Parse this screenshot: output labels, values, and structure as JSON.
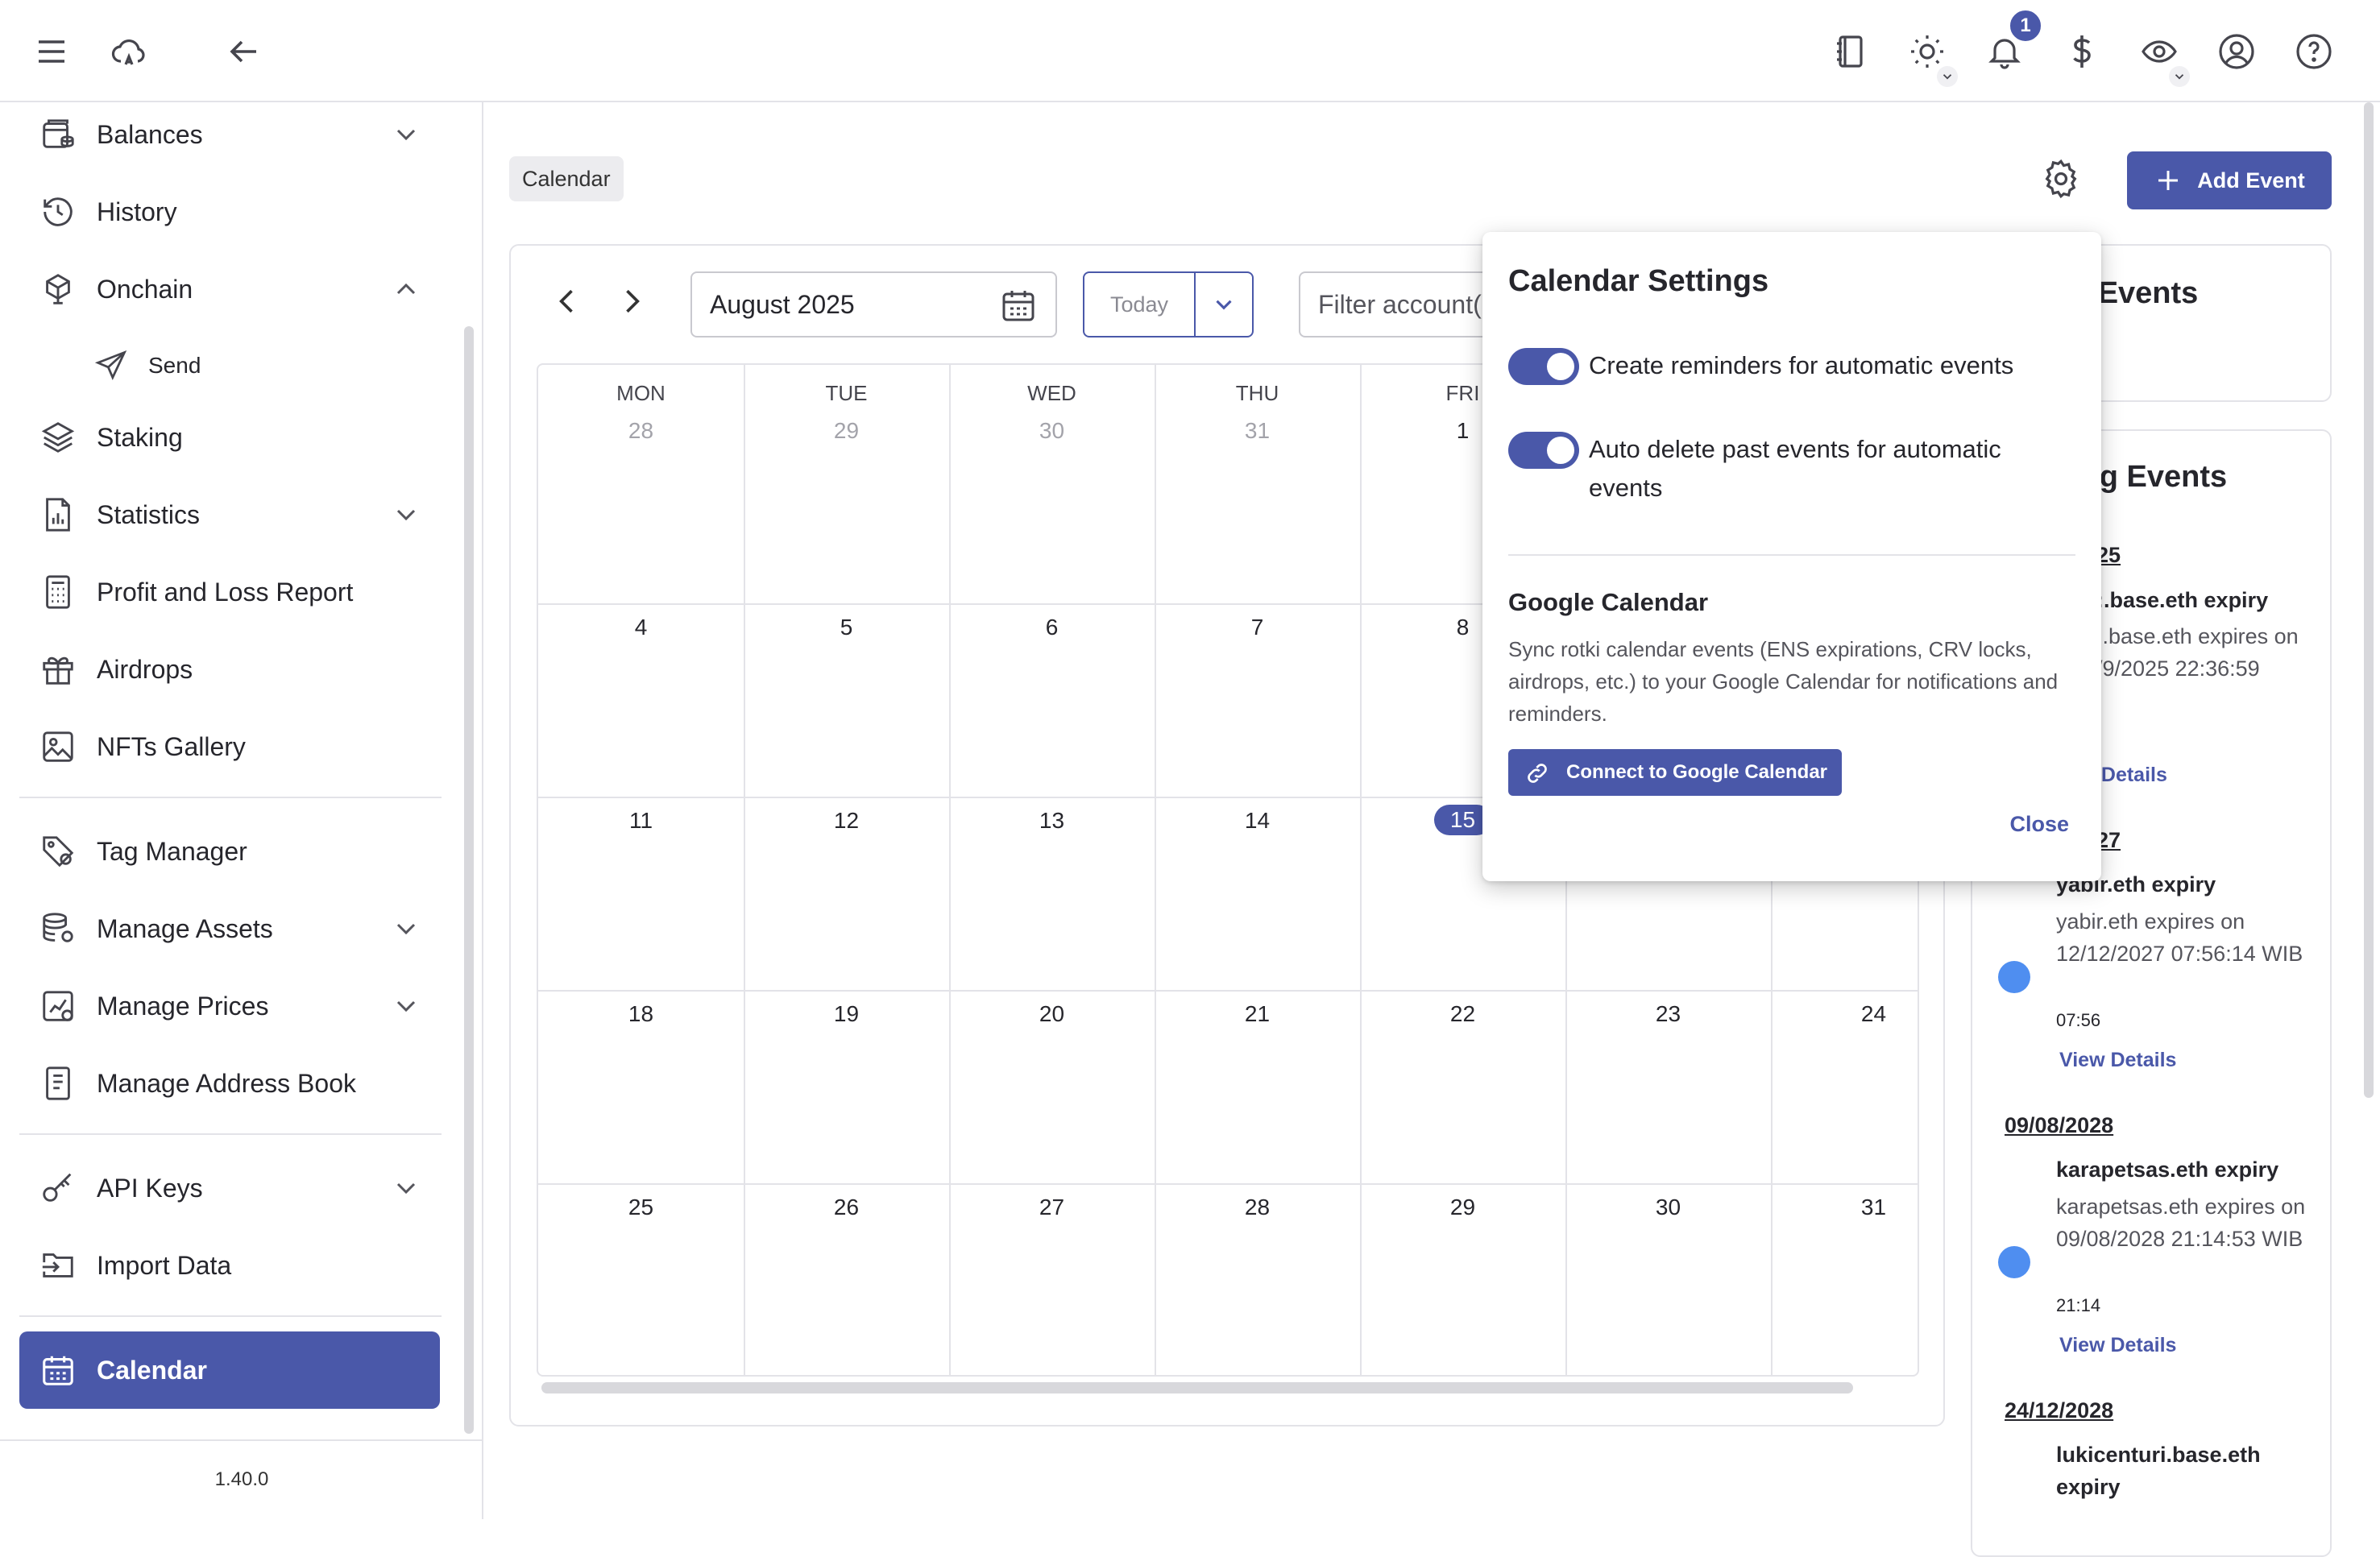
{
  "topbar": {
    "notifications_count": "1"
  },
  "sidebar": {
    "items": [
      {
        "label": "Balances"
      },
      {
        "label": "History"
      },
      {
        "label": "Onchain"
      },
      {
        "label": "Send"
      },
      {
        "label": "Staking"
      },
      {
        "label": "Statistics"
      },
      {
        "label": "Profit and Loss Report"
      },
      {
        "label": "Airdrops"
      },
      {
        "label": "NFTs Gallery"
      },
      {
        "label": "Tag Manager"
      },
      {
        "label": "Manage Assets"
      },
      {
        "label": "Manage Prices"
      },
      {
        "label": "Manage Address Book"
      },
      {
        "label": "API Keys"
      },
      {
        "label": "Import Data"
      },
      {
        "label": "Calendar"
      }
    ],
    "version": "1.40.0"
  },
  "main": {
    "breadcrumb": "Calendar",
    "add_event_label": "Add Event",
    "month_value": "August 2025",
    "today_label": "Today",
    "filter_placeholder": "Filter account(",
    "weekdays": [
      "MON",
      "TUE",
      "WED",
      "THU",
      "FRI"
    ],
    "weeks": [
      [
        "28",
        "29",
        "30",
        "31",
        "1"
      ],
      [
        "4",
        "5",
        "6",
        "7",
        "8"
      ],
      [
        "11",
        "12",
        "13",
        "14",
        "15"
      ],
      [
        "18",
        "19",
        "20",
        "21",
        "22",
        "23",
        "24"
      ],
      [
        "25",
        "26",
        "27",
        "28",
        "29",
        "30",
        "31"
      ]
    ],
    "today_day": "15"
  },
  "events": {
    "card1_title": "s Events",
    "card2_title": "ing Events",
    "items": [
      {
        "date": "25",
        "name": ":.base.eth expiry",
        "desc": ":.base.eth expires on /9/2025 22:36:59",
        "extra": ",",
        "link": "/ Details"
      },
      {
        "date": "27",
        "name": "yabir.eth expiry",
        "desc": "yabir.eth expires on 12/12/2027 07:56:14 WIB",
        "time": "07:56",
        "link": "View Details"
      },
      {
        "date": "09/08/2028",
        "name": "karapetsas.eth expiry",
        "desc": "karapetsas.eth expires on 09/08/2028 21:14:53 WIB",
        "time": "21:14",
        "link": "View Details"
      },
      {
        "date": "24/12/2028",
        "name": "lukicenturi.base.eth expiry"
      }
    ]
  },
  "popup": {
    "title": "Calendar Settings",
    "toggle1_label": "Create reminders for automatic events",
    "toggle2_label": "Auto delete past events for automatic events",
    "google_title": "Google Calendar",
    "google_desc": "Sync rotki calendar events (ENS expirations, CRV locks, airdrops, etc.) to your Google Calendar for notifications and reminders.",
    "connect_label": "Connect to Google Calendar",
    "close_label": "Close"
  },
  "colors": {
    "accent": "#4a58a9",
    "event_dot": "#4f8ef0"
  }
}
